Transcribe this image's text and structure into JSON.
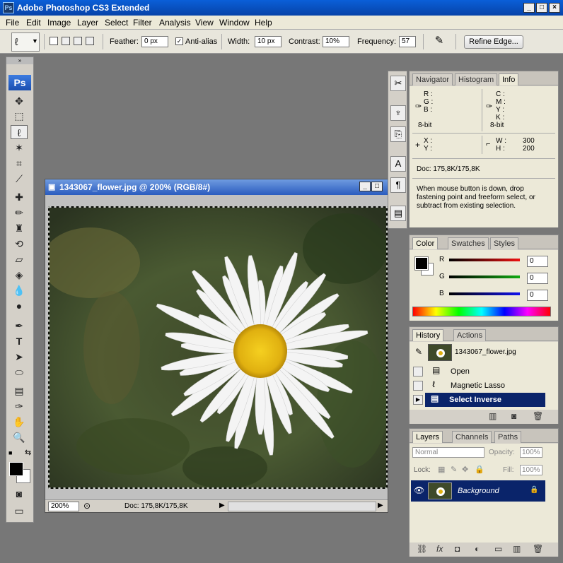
{
  "app": {
    "title": "Adobe Photoshop CS3 Extended",
    "logo": "Ps"
  },
  "menu": [
    "File",
    "Edit",
    "Image",
    "Layer",
    "Select",
    "Filter",
    "Analysis",
    "View",
    "Window",
    "Help"
  ],
  "options": {
    "feather_label": "Feather:",
    "feather_value": "0 px",
    "antialias_label": "Anti-alias",
    "width_label": "Width:",
    "width_value": "10 px",
    "contrast_label": "Contrast:",
    "contrast_value": "10%",
    "frequency_label": "Frequency:",
    "frequency_value": "57",
    "refine_edge": "Refine Edge..."
  },
  "document": {
    "title": "1343067_flower.jpg @ 200% (RGB/8#)",
    "zoom": "200%",
    "doc_size": "Doc: 175,8K/175,8K"
  },
  "info_panel": {
    "tabs": [
      "Navigator",
      "Histogram",
      "Info"
    ],
    "rgb": [
      "R :",
      "G :",
      "B :"
    ],
    "cmyk": [
      "C :",
      "M :",
      "Y :",
      "K :"
    ],
    "bit1": "8-bit",
    "bit2": "8-bit",
    "xy": [
      "X :",
      "Y :"
    ],
    "wh_labels": [
      "W :",
      "H :"
    ],
    "w_value": "300",
    "h_value": "200",
    "doc": "Doc: 175,8K/175,8K",
    "hint": "When mouse button is down, drop fastening point and freeform select, or subtract from existing selection."
  },
  "color_panel": {
    "tabs": [
      "Color",
      "Swatches",
      "Styles"
    ],
    "channels": [
      {
        "label": "R",
        "value": "0"
      },
      {
        "label": "G",
        "value": "0"
      },
      {
        "label": "B",
        "value": "0"
      }
    ],
    "colors": {
      "r": "#e11",
      "g": "#1a1",
      "b": "#11e"
    }
  },
  "history_panel": {
    "tabs": [
      "History",
      "Actions"
    ],
    "snapshot": "1343067_flower.jpg",
    "items": [
      "Open",
      "Magnetic Lasso",
      "Select Inverse"
    ]
  },
  "layers_panel": {
    "tabs": [
      "Layers",
      "Channels",
      "Paths"
    ],
    "blend_mode": "Normal",
    "opacity_label": "Opacity:",
    "opacity_value": "100%",
    "lock_label": "Lock:",
    "fill_label": "Fill:",
    "fill_value": "100%",
    "layer_name": "Background"
  }
}
